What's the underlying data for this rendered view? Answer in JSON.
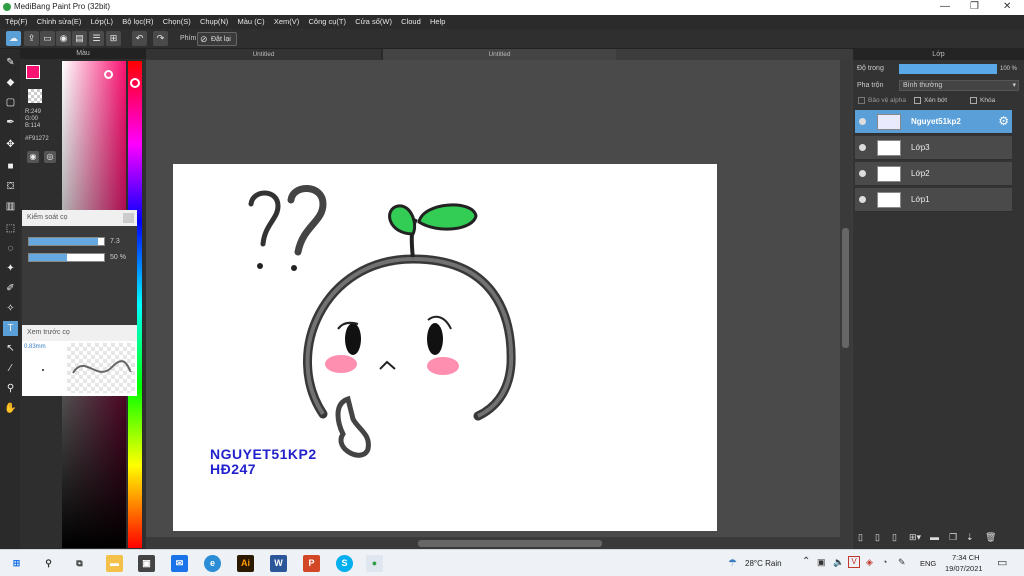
{
  "window": {
    "title": "MediBang Paint Pro (32bit)"
  },
  "menu": [
    "Tệp(F)",
    "Chỉnh sửa(E)",
    "Lớp(L)",
    "Bộ lọc(R)",
    "Chọn(S)",
    "Chụp(N)",
    "Màu (C)",
    "Xem(V)",
    "Công cụ(T)",
    "Cửa sổ(W)",
    "Cloud",
    "Help"
  ],
  "toolbar": {
    "phim_label": "Phím",
    "reset_label": "Đặt lại"
  },
  "color_panel": {
    "title": "Màu",
    "primary_color": "#F91272",
    "r": "R:249",
    "g": "G:00",
    "b": "B:114",
    "hex": "#F91272"
  },
  "brush_control": {
    "title": "Kiểm soát cọ",
    "size_value": "7.3",
    "size_fraction": 0.92,
    "opacity_value": "50 %",
    "opacity_fraction": 0.5
  },
  "brush_preview": {
    "title": "Xem trước cọ",
    "size": "0.83mm"
  },
  "tabs": [
    "Untitled",
    "Untitled"
  ],
  "canvas": {
    "signature_line1": "NGUYET51KP2",
    "signature_line2": "HĐ247"
  },
  "layer_panel": {
    "title": "Lớp",
    "opacity_label": "Độ trong",
    "opacity_value": "100 %",
    "blend_label": "Pha trộn",
    "blend_value": "Bình thường",
    "protect_alpha": "Bảo vệ alpha",
    "clipping": "Xén bớt",
    "lock": "Khóa",
    "layers": [
      {
        "name": "Nguyet51kp2",
        "selected": true
      },
      {
        "name": "Lớp3",
        "selected": false
      },
      {
        "name": "Lớp2",
        "selected": false
      },
      {
        "name": "Lớp1",
        "selected": false
      }
    ]
  },
  "taskbar": {
    "weather": "28°C Rain",
    "language": "ENG",
    "time": "7:34 CH",
    "date": "19/07/2021"
  },
  "accent_color": "#5a9fd8"
}
